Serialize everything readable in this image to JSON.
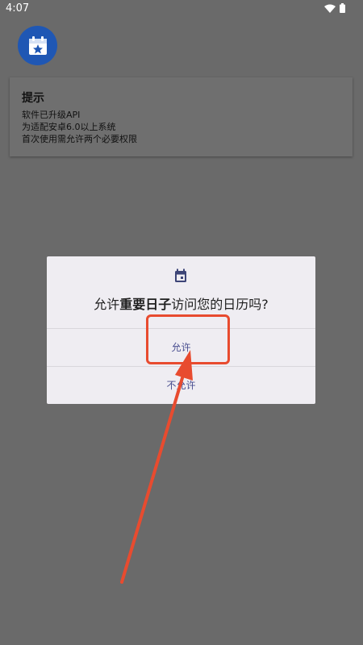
{
  "status_bar": {
    "time": "4:07",
    "wifi_icon": "wifi-icon",
    "battery_icon": "battery-icon"
  },
  "app": {
    "icon": "calendar-star-icon",
    "icon_color": "#1f57b4"
  },
  "notice": {
    "title": "提示",
    "lines": [
      "软件已升级API",
      "为适配安卓6.0以上系统",
      "首次使用需允许两个必要权限"
    ]
  },
  "dialog": {
    "icon": "calendar-icon",
    "message_prefix": "允许",
    "app_name": "重要日子",
    "message_suffix": "访问您的日历吗?",
    "allow_label": "允许",
    "deny_label": "不允许",
    "button_color": "#4a4f90"
  },
  "annotation": {
    "color": "#e84b2f"
  }
}
